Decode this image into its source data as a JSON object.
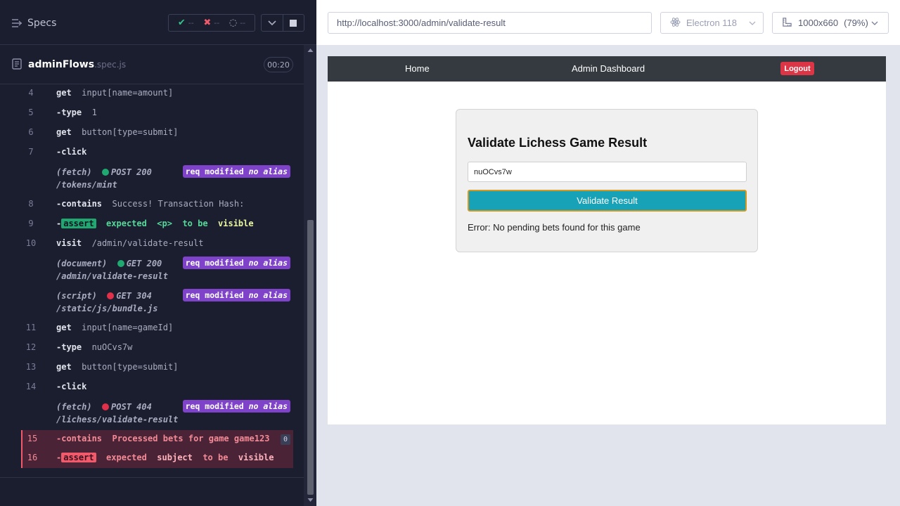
{
  "reporter": {
    "specs_label": "Specs",
    "stats": {
      "passed": "--",
      "failed": "--",
      "pending": "--"
    },
    "spec_file": {
      "name": "adminFlows",
      "ext": ".spec.js",
      "duration": "00:20"
    },
    "commands": [
      {
        "num": "4",
        "name": "get",
        "msg": "input[name=amount]"
      },
      {
        "num": "5",
        "name": "-type",
        "msg": "1"
      },
      {
        "num": "6",
        "name": "get",
        "msg": "button[type=submit]"
      },
      {
        "num": "7",
        "name": "-click",
        "msg": ""
      },
      {
        "num": "8",
        "name": "-contains",
        "msg": "Success! Transaction Hash:"
      },
      {
        "num": "10",
        "name": "visit",
        "msg": "/admin/validate-result"
      },
      {
        "num": "11",
        "name": "get",
        "msg": "input[name=gameId]"
      },
      {
        "num": "12",
        "name": "-type",
        "msg": "nuOCvs7w"
      },
      {
        "num": "13",
        "name": "get",
        "msg": "button[type=submit]"
      },
      {
        "num": "14",
        "name": "-click",
        "msg": ""
      }
    ],
    "assert9": {
      "num": "9",
      "dash": "-",
      "tag": "assert",
      "w1": "expected",
      "w2": "<p>",
      "w3": "to be",
      "w4": "visible"
    },
    "requests": [
      {
        "type": "(fetch)",
        "method": "POST 200",
        "path": "/tokens/mint",
        "status_color": "#1fa971",
        "badge": "req modified",
        "alias": "no alias"
      },
      {
        "type": "(document)",
        "method": "GET 200",
        "path": "/admin/validate-result",
        "status_color": "#1fa971",
        "badge": "req modified",
        "alias": "no alias"
      },
      {
        "type": "(script)",
        "method": "GET 304",
        "path": "/static/js/bundle.js",
        "status_color": "#e0304a",
        "badge": "req modified",
        "alias": "no alias"
      },
      {
        "type": "(fetch)",
        "method": "POST 404",
        "path": "/lichess/validate-result",
        "status_color": "#e0304a",
        "badge": "req modified",
        "alias": "no alias"
      }
    ],
    "failed15": {
      "num": "15",
      "name": "-contains",
      "msg": "Processed bets for game game123",
      "count": "0"
    },
    "failed16": {
      "num": "16",
      "dash": "-",
      "tag": "assert",
      "w1": "expected",
      "w2": "subject",
      "w3": "to be",
      "w4": "visible"
    }
  },
  "aut": {
    "url": "http://localhost:3000/admin/validate-result",
    "browser": "Electron 118",
    "viewport": "1000x660",
    "zoom": "(79%)"
  },
  "app": {
    "nav": {
      "home": "Home",
      "dashboard": "Admin Dashboard",
      "logout": "Logout"
    },
    "card": {
      "title": "Validate Lichess Game Result",
      "input_value": "nuOCvs7w",
      "button": "Validate Result",
      "error": "Error: No pending bets found for this game"
    }
  },
  "colors": {
    "pass": "#1fa971",
    "fail": "#e0304a",
    "badge": "#7f43c9",
    "primary": "#17a2b8",
    "danger": "#dc3545"
  }
}
